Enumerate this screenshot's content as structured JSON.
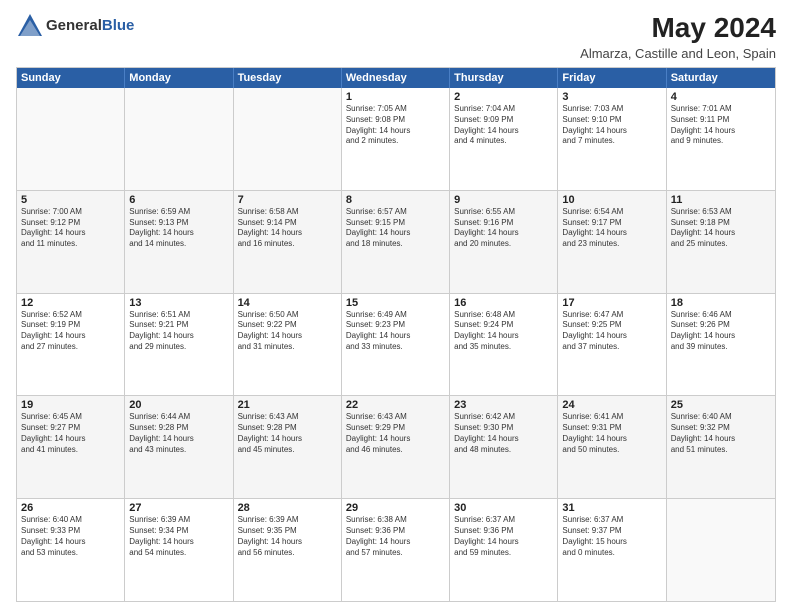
{
  "header": {
    "logo_general": "General",
    "logo_blue": "Blue",
    "title": "May 2024",
    "subtitle": "Almarza, Castille and Leon, Spain"
  },
  "days_of_week": [
    "Sunday",
    "Monday",
    "Tuesday",
    "Wednesday",
    "Thursday",
    "Friday",
    "Saturday"
  ],
  "weeks": [
    [
      {
        "day": "",
        "empty": true
      },
      {
        "day": "",
        "empty": true
      },
      {
        "day": "",
        "empty": true
      },
      {
        "day": "1",
        "info": "Sunrise: 7:05 AM\nSunset: 9:08 PM\nDaylight: 14 hours\nand 2 minutes."
      },
      {
        "day": "2",
        "info": "Sunrise: 7:04 AM\nSunset: 9:09 PM\nDaylight: 14 hours\nand 4 minutes."
      },
      {
        "day": "3",
        "info": "Sunrise: 7:03 AM\nSunset: 9:10 PM\nDaylight: 14 hours\nand 7 minutes."
      },
      {
        "day": "4",
        "info": "Sunrise: 7:01 AM\nSunset: 9:11 PM\nDaylight: 14 hours\nand 9 minutes."
      }
    ],
    [
      {
        "day": "5",
        "info": "Sunrise: 7:00 AM\nSunset: 9:12 PM\nDaylight: 14 hours\nand 11 minutes."
      },
      {
        "day": "6",
        "info": "Sunrise: 6:59 AM\nSunset: 9:13 PM\nDaylight: 14 hours\nand 14 minutes."
      },
      {
        "day": "7",
        "info": "Sunrise: 6:58 AM\nSunset: 9:14 PM\nDaylight: 14 hours\nand 16 minutes."
      },
      {
        "day": "8",
        "info": "Sunrise: 6:57 AM\nSunset: 9:15 PM\nDaylight: 14 hours\nand 18 minutes."
      },
      {
        "day": "9",
        "info": "Sunrise: 6:55 AM\nSunset: 9:16 PM\nDaylight: 14 hours\nand 20 minutes."
      },
      {
        "day": "10",
        "info": "Sunrise: 6:54 AM\nSunset: 9:17 PM\nDaylight: 14 hours\nand 23 minutes."
      },
      {
        "day": "11",
        "info": "Sunrise: 6:53 AM\nSunset: 9:18 PM\nDaylight: 14 hours\nand 25 minutes."
      }
    ],
    [
      {
        "day": "12",
        "info": "Sunrise: 6:52 AM\nSunset: 9:19 PM\nDaylight: 14 hours\nand 27 minutes."
      },
      {
        "day": "13",
        "info": "Sunrise: 6:51 AM\nSunset: 9:21 PM\nDaylight: 14 hours\nand 29 minutes."
      },
      {
        "day": "14",
        "info": "Sunrise: 6:50 AM\nSunset: 9:22 PM\nDaylight: 14 hours\nand 31 minutes."
      },
      {
        "day": "15",
        "info": "Sunrise: 6:49 AM\nSunset: 9:23 PM\nDaylight: 14 hours\nand 33 minutes."
      },
      {
        "day": "16",
        "info": "Sunrise: 6:48 AM\nSunset: 9:24 PM\nDaylight: 14 hours\nand 35 minutes."
      },
      {
        "day": "17",
        "info": "Sunrise: 6:47 AM\nSunset: 9:25 PM\nDaylight: 14 hours\nand 37 minutes."
      },
      {
        "day": "18",
        "info": "Sunrise: 6:46 AM\nSunset: 9:26 PM\nDaylight: 14 hours\nand 39 minutes."
      }
    ],
    [
      {
        "day": "19",
        "info": "Sunrise: 6:45 AM\nSunset: 9:27 PM\nDaylight: 14 hours\nand 41 minutes."
      },
      {
        "day": "20",
        "info": "Sunrise: 6:44 AM\nSunset: 9:28 PM\nDaylight: 14 hours\nand 43 minutes."
      },
      {
        "day": "21",
        "info": "Sunrise: 6:43 AM\nSunset: 9:28 PM\nDaylight: 14 hours\nand 45 minutes."
      },
      {
        "day": "22",
        "info": "Sunrise: 6:43 AM\nSunset: 9:29 PM\nDaylight: 14 hours\nand 46 minutes."
      },
      {
        "day": "23",
        "info": "Sunrise: 6:42 AM\nSunset: 9:30 PM\nDaylight: 14 hours\nand 48 minutes."
      },
      {
        "day": "24",
        "info": "Sunrise: 6:41 AM\nSunset: 9:31 PM\nDaylight: 14 hours\nand 50 minutes."
      },
      {
        "day": "25",
        "info": "Sunrise: 6:40 AM\nSunset: 9:32 PM\nDaylight: 14 hours\nand 51 minutes."
      }
    ],
    [
      {
        "day": "26",
        "info": "Sunrise: 6:40 AM\nSunset: 9:33 PM\nDaylight: 14 hours\nand 53 minutes."
      },
      {
        "day": "27",
        "info": "Sunrise: 6:39 AM\nSunset: 9:34 PM\nDaylight: 14 hours\nand 54 minutes."
      },
      {
        "day": "28",
        "info": "Sunrise: 6:39 AM\nSunset: 9:35 PM\nDaylight: 14 hours\nand 56 minutes."
      },
      {
        "day": "29",
        "info": "Sunrise: 6:38 AM\nSunset: 9:36 PM\nDaylight: 14 hours\nand 57 minutes."
      },
      {
        "day": "30",
        "info": "Sunrise: 6:37 AM\nSunset: 9:36 PM\nDaylight: 14 hours\nand 59 minutes."
      },
      {
        "day": "31",
        "info": "Sunrise: 6:37 AM\nSunset: 9:37 PM\nDaylight: 15 hours\nand 0 minutes."
      },
      {
        "day": "",
        "empty": true
      }
    ]
  ]
}
